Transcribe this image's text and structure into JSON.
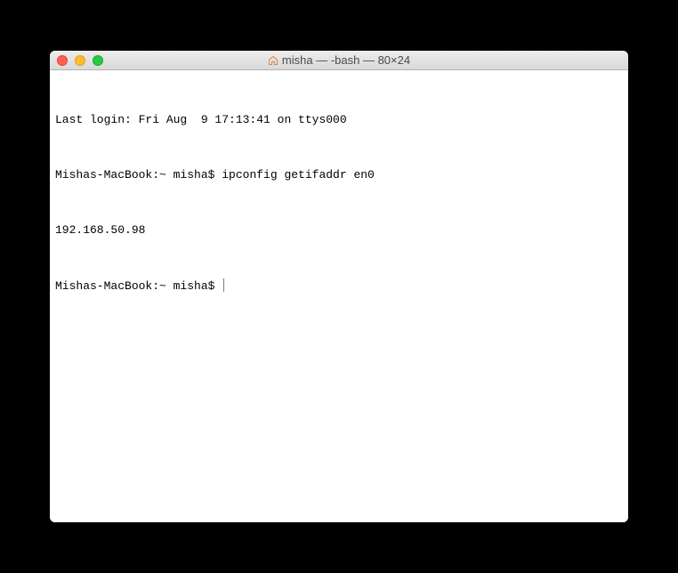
{
  "titlebar": {
    "title": "misha — -bash — 80×24",
    "icon": "home-icon"
  },
  "terminal": {
    "lines": [
      {
        "text": "Last login: Fri Aug  9 17:13:41 on ttys000"
      },
      {
        "prompt": "Mishas-MacBook:~ misha$ ",
        "command": "ipconfig getifaddr en0"
      },
      {
        "text": "192.168.50.98"
      },
      {
        "prompt": "Mishas-MacBook:~ misha$ ",
        "command": "",
        "cursor": true
      }
    ]
  }
}
